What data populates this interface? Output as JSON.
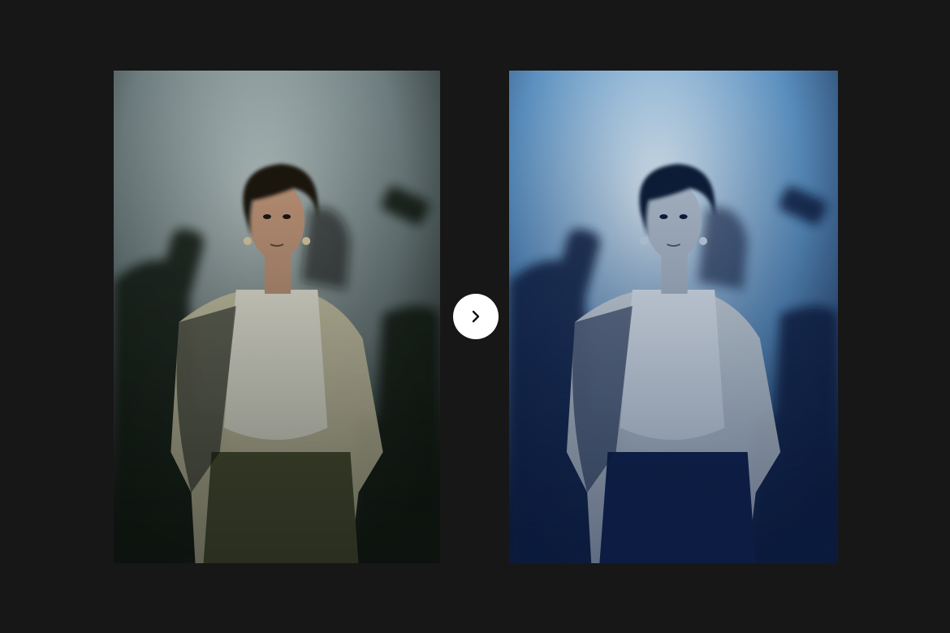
{
  "comparison": {
    "before": {
      "photo_icon": "portrait-photo",
      "palette": {
        "wall_light": "#b9c6c6",
        "wall_dark": "#6f7e80",
        "shadow": "#0d1310",
        "skin": "#c79a7d",
        "hair": "#1a1410",
        "shirt": "#f3f1e3",
        "blazer": "#d9d2b0",
        "pants": "#4d5033",
        "accent_warm": "#e8d6a8"
      }
    },
    "after": {
      "photo_icon": "portrait-photo-blue-tint",
      "palette": {
        "wall_light": "#e4f0f7",
        "wall_dark": "#5d92c1",
        "shadow": "#0a1a3c",
        "skin": "#b6c2cf",
        "hair": "#0c1a35",
        "shirt": "#eef6fb",
        "blazer": "#dfe6e6",
        "pants": "#0f1f48",
        "accent_warm": "#cfe0ee"
      }
    },
    "arrow_button": {
      "icon": "chevron-right-icon",
      "background": "#ffffff",
      "foreground": "#111111"
    }
  }
}
